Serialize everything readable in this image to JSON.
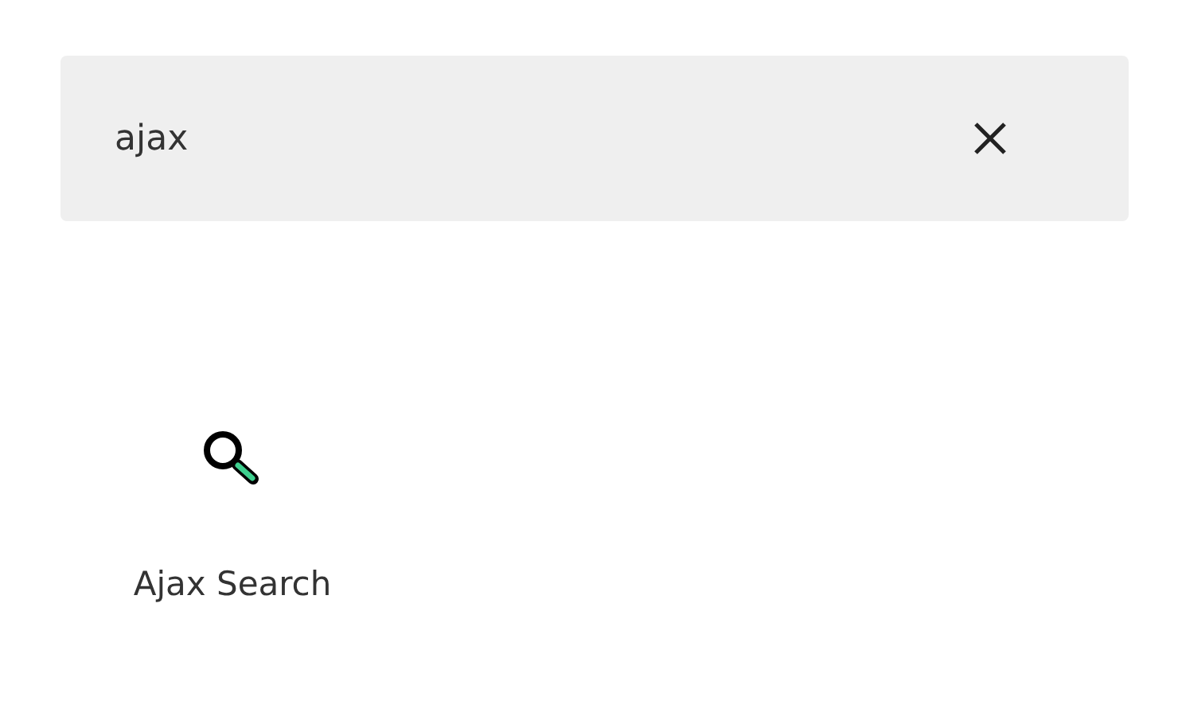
{
  "search": {
    "value": "ajax"
  },
  "results": [
    {
      "label": "Ajax Search"
    }
  ]
}
